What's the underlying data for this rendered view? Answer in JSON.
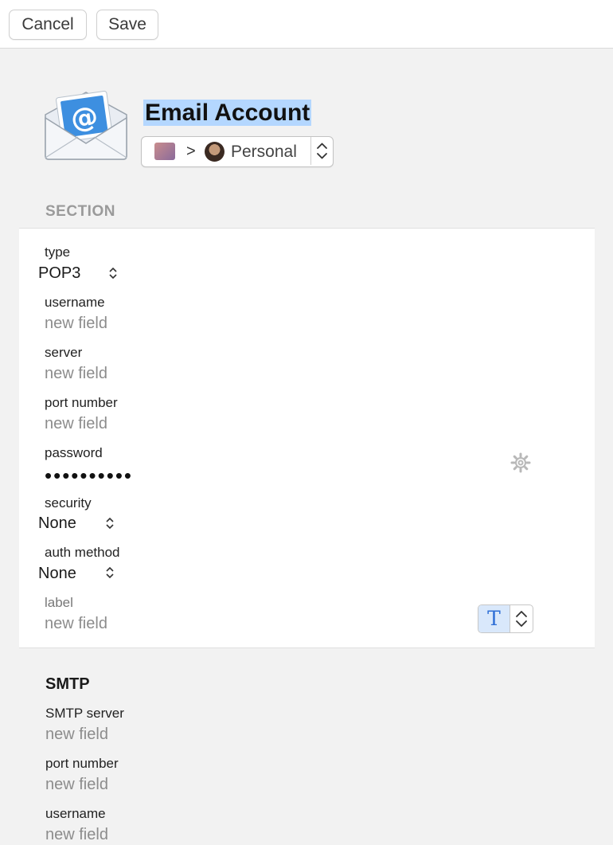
{
  "toolbar": {
    "cancel_label": "Cancel",
    "save_label": "Save"
  },
  "header": {
    "title": "Email Account",
    "vault_path": {
      "separator": ">",
      "vault_name": "Personal"
    },
    "icon": "email-envelope-icon"
  },
  "section": {
    "heading": "SECTION",
    "fields": [
      {
        "label": "type",
        "value": "POP3",
        "kind": "select"
      },
      {
        "label": "username",
        "placeholder": "new field"
      },
      {
        "label": "server",
        "placeholder": "new field"
      },
      {
        "label": "port number",
        "placeholder": "new field"
      },
      {
        "label": "password",
        "value": "••••••••••",
        "kind": "password"
      },
      {
        "label": "security",
        "value": "None",
        "kind": "select"
      },
      {
        "label": "auth method",
        "value": "None",
        "kind": "select"
      },
      {
        "label": "label",
        "placeholder": "new field",
        "kind": "new"
      }
    ],
    "text_type_icon": "T"
  },
  "smtp": {
    "title": "SMTP",
    "fields": [
      {
        "label": "SMTP server",
        "placeholder": "new field"
      },
      {
        "label": "port number",
        "placeholder": "new field"
      },
      {
        "label": "username",
        "placeholder": "new field"
      }
    ]
  },
  "colors": {
    "title_highlight": "#b4d7ff",
    "accent": "#2f6fd6",
    "background": "#f2f2f2"
  }
}
